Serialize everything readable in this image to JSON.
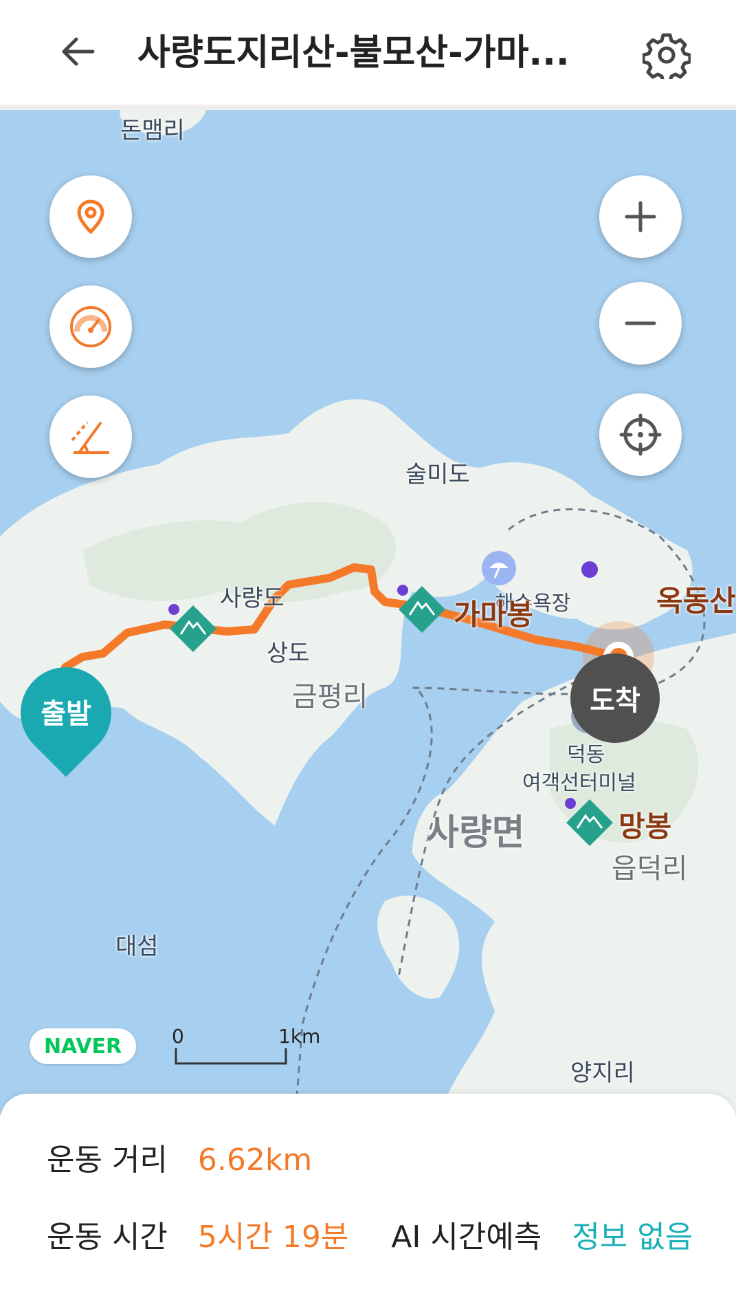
{
  "header": {
    "title": "사량도지리산-불모산-가마...",
    "back_icon": "arrow-left-icon",
    "settings_icon": "gear-icon"
  },
  "map": {
    "left_controls": [
      {
        "icon": "location-pin-icon"
      },
      {
        "icon": "speedometer-icon"
      },
      {
        "icon": "elevation-slope-icon"
      }
    ],
    "right_controls": [
      {
        "icon": "plus-icon"
      },
      {
        "icon": "minus-icon"
      },
      {
        "icon": "crosshair-icon"
      }
    ],
    "labels": {
      "top_left_place": "돈맴리",
      "sulmido": "술미도",
      "saryangdo": "사량도",
      "sangdo": "상도",
      "geumpyeongri": "금평리",
      "beach": "해수욕장",
      "deokdong": "덕동",
      "terminal": "여객선터미널",
      "saryangmyeon": "사량면",
      "eupdeokri": "읍덕리",
      "daeseom": "대섬",
      "yangjiri": "양지리"
    },
    "peaks": {
      "gamabong": "가마봉",
      "ogdongsan": "옥동산",
      "mangbong": "망봉"
    },
    "markers": {
      "start": "출발",
      "end": "도착"
    },
    "route_color": "#f47a2a",
    "scale": {
      "zero": "0",
      "one": "1km"
    },
    "logo": "NAVER"
  },
  "stats": {
    "distance_label": "운동 거리",
    "distance_value": "6.62km",
    "time_label": "운동 시간",
    "time_value": "5시간 19분",
    "ai_label": "AI 시간예측",
    "ai_value": "정보 없음"
  },
  "colors": {
    "accent": "#f47a2a",
    "teal": "#1aa9b0",
    "water": "#a7cfef",
    "land": "#f3f4f2"
  }
}
